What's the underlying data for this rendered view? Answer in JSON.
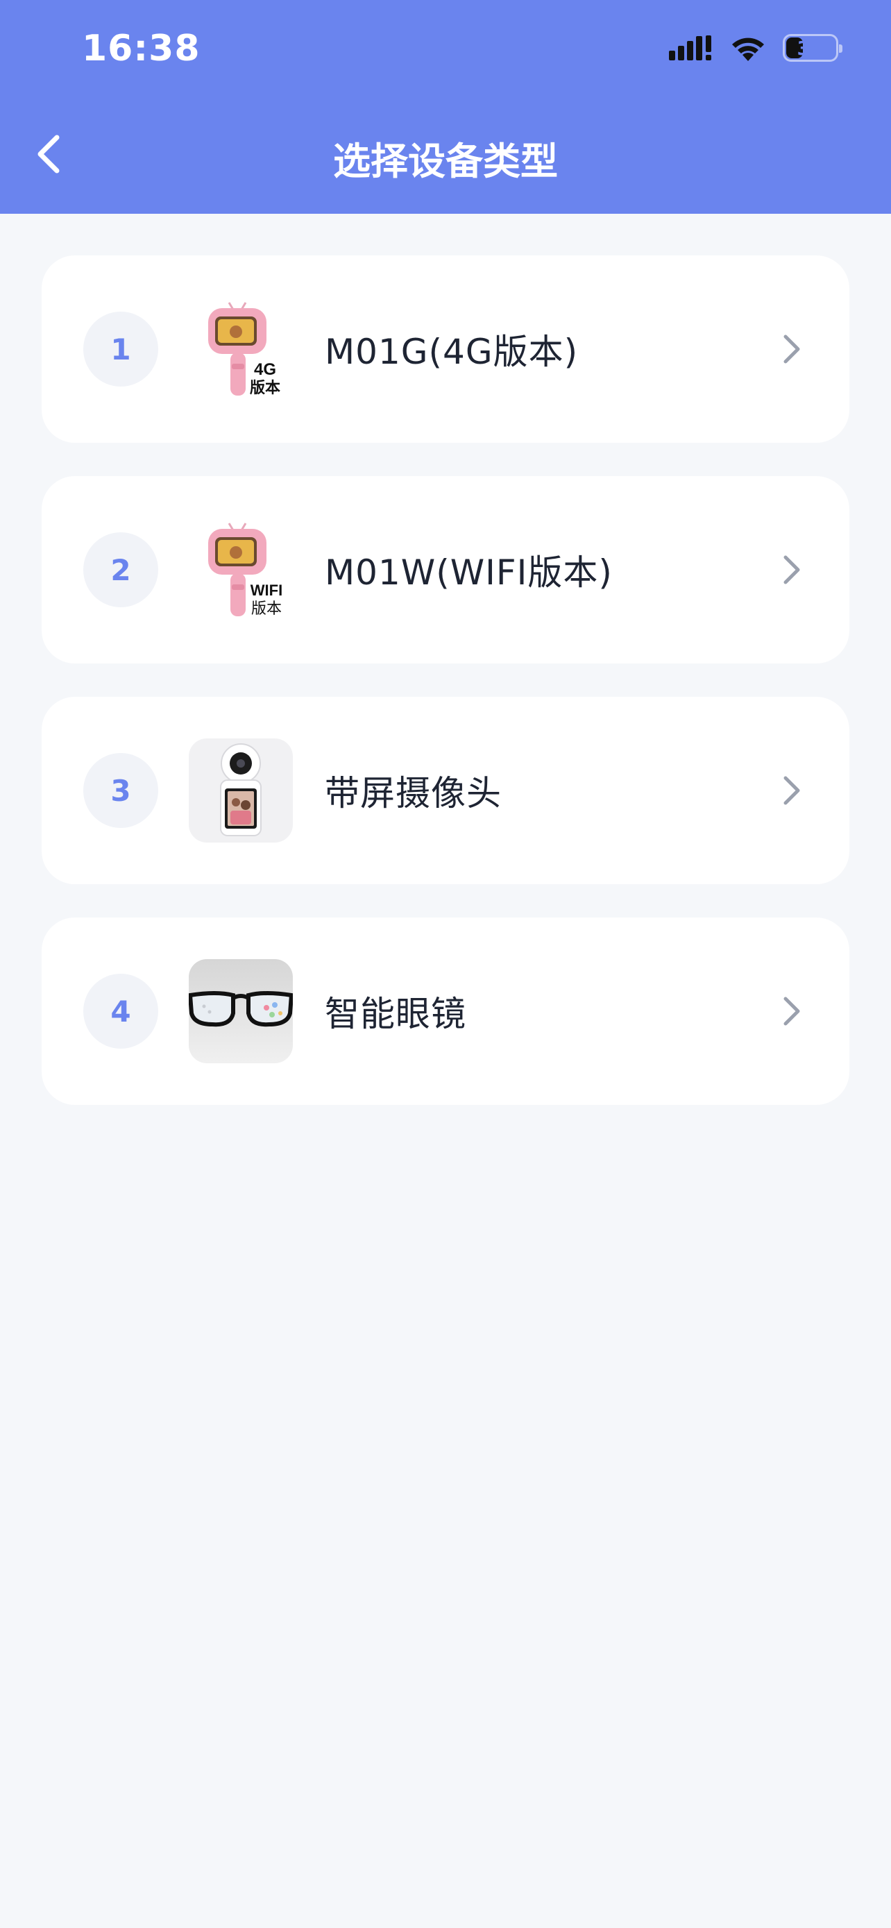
{
  "status_bar": {
    "time": "16:38",
    "battery": "33",
    "battery_level": 0.33
  },
  "header": {
    "title": "选择设备类型",
    "back_icon": "chevron-left-icon"
  },
  "devices": [
    {
      "index": "1",
      "name": "M01G(4G版本)",
      "badge_top": "4G",
      "badge_bottom": "版本",
      "image": "pink-kids-camera-stick"
    },
    {
      "index": "2",
      "name": "M01W(WIFI版本)",
      "badge_top": "WIFI",
      "badge_bottom": "版本",
      "image": "pink-kids-camera-stick"
    },
    {
      "index": "3",
      "name": "带屏摄像头",
      "image": "screen-camera"
    },
    {
      "index": "4",
      "name": "智能眼镜",
      "image": "smart-glasses"
    }
  ],
  "colors": {
    "accent": "#6a84ee",
    "background": "#f5f7fa",
    "card": "#ffffff",
    "text": "#1e2433",
    "chevron": "#9aa0ad"
  }
}
